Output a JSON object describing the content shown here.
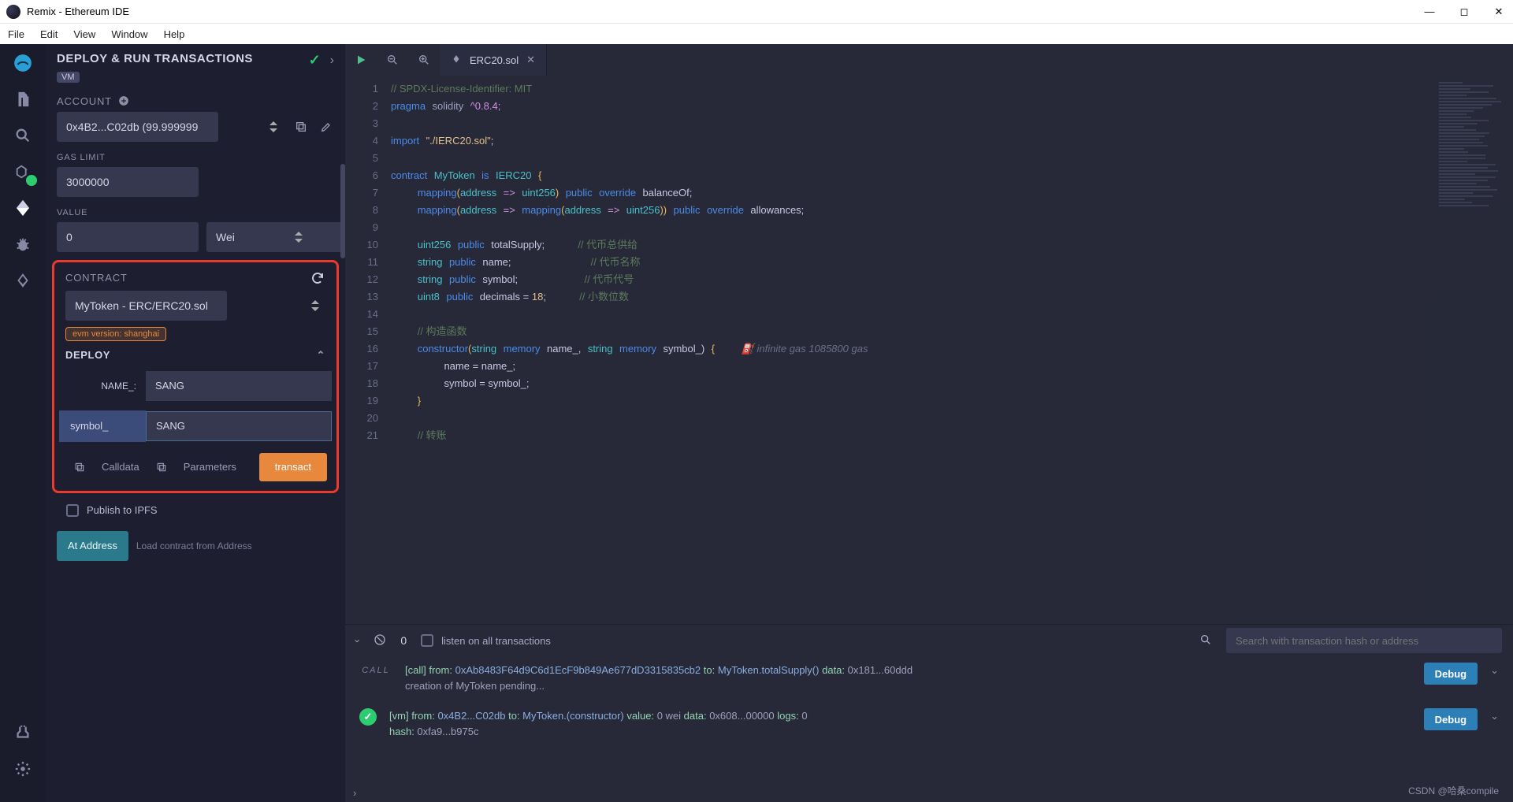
{
  "window": {
    "title": "Remix - Ethereum IDE"
  },
  "menu": [
    "File",
    "Edit",
    "View",
    "Window",
    "Help"
  ],
  "winbtns": {
    "min": "—",
    "max": "◻",
    "close": "✕"
  },
  "panel": {
    "title": "DEPLOY & RUN TRANSACTIONS",
    "vm": "VM",
    "account_label": "ACCOUNT",
    "account_value": "0x4B2...C02db (99.999999",
    "gas_label": "GAS LIMIT",
    "gas_value": "3000000",
    "value_label": "VALUE",
    "value_amount": "0",
    "value_unit": "Wei",
    "contract_label": "CONTRACT",
    "contract_sel": "MyToken - ERC/ERC20.sol",
    "evm_tag": "evm version: shanghai",
    "deploy_label": "DEPLOY",
    "params": {
      "name_label": "NAME_:",
      "name_value": "SANG",
      "symbol_label": "symbol_",
      "symbol_value": "SANG"
    },
    "calldata": "Calldata",
    "parameters": "Parameters",
    "transact": "transact",
    "publish": "Publish to IPFS",
    "at_address": "At Address",
    "at_address_ph": "Load contract from Address"
  },
  "tab": {
    "name": "ERC20.sol"
  },
  "code": {
    "lines": [
      1,
      2,
      3,
      4,
      5,
      6,
      7,
      8,
      9,
      10,
      11,
      12,
      13,
      14,
      15,
      16,
      17,
      18,
      19,
      20,
      21
    ],
    "l1": "// SPDX-License-Identifier: MIT",
    "l2a": "pragma",
    "l2b": "solidity",
    "l2c": "^0.8.4;",
    "l4a": "import",
    "l4b": "\"./IERC20.sol\"",
    "l4c": ";",
    "l6a": "contract",
    "l6b": "MyToken",
    "l6c": "is",
    "l6d": "IERC20",
    "l6e": "{",
    "l7a": "mapping",
    "l7b": "(",
    "l7c": "address",
    "l7d": "=>",
    "l7e": "uint256",
    "l7f": ")",
    "l7g": "public",
    "l7h": "override",
    "l7i": "balanceOf;",
    "l8a": "mapping",
    "l8b": "(",
    "l8c": "address",
    "l8d": "=>",
    "l8e": "mapping",
    "l8f": "(",
    "l8g": "address",
    "l8h": "=>",
    "l8i": "uint256",
    "l8j": "))",
    "l8k": "public",
    "l8l": "override",
    "l8m": "allowances;",
    "l10a": "uint256",
    "l10b": "public",
    "l10c": "totalSupply;",
    "l10d": "// 代币总供给",
    "l11a": "string",
    "l11b": "public",
    "l11c": "name;",
    "l11d": "// 代币名称",
    "l12a": "string",
    "l12b": "public",
    "l12c": "symbol;",
    "l12d": "// 代币代号",
    "l13a": "uint8",
    "l13b": "public",
    "l13c": "decimals = ",
    "l13d": "18",
    "l13e": ";",
    "l13f": "// 小数位数",
    "l15": "// 构造函数",
    "l16a": "constructor",
    "l16b": "(",
    "l16c": "string",
    "l16d": "memory",
    "l16e": "name_,",
    "l16f": "string",
    "l16g": "memory",
    "l16h": "symbol_)",
    "l16i": "{",
    "l16hint": "infinite gas 1085800 gas",
    "l17": "name = name_;",
    "l18": "symbol = symbol_;",
    "l19": "}",
    "l21": "// 转账"
  },
  "term": {
    "zero": "0",
    "listen": "listen on all transactions",
    "search_ph": "Search with transaction hash or address",
    "debug": "Debug",
    "row1": "[call]  from: 0xAb8483F64d9C6d1EcF9b849Ae677dD3315835cb2 to: MyToken.totalSupply() data: 0x181...60ddd",
    "row1b": "creation of MyToken pending...",
    "row2a": "[vm]  from: 0x4B2...C02db to: MyToken.(constructor) value: 0 wei data: 0x608...00000 logs: 0",
    "row2b": "hash: 0xfa9...b975c"
  },
  "status": "CSDN @哈桑compile"
}
